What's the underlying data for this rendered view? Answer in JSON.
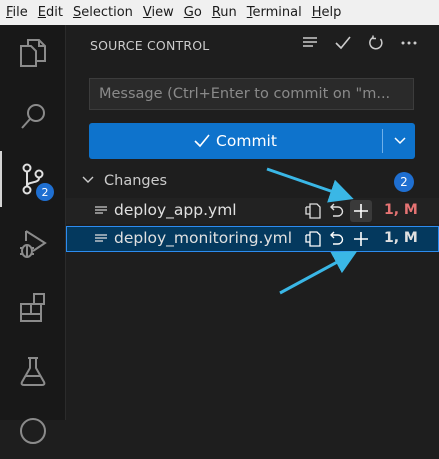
{
  "menubar": {
    "items": [
      {
        "first": "F",
        "rest": "ile"
      },
      {
        "first": "E",
        "rest": "dit"
      },
      {
        "first": "S",
        "rest": "election"
      },
      {
        "first": "V",
        "rest": "iew"
      },
      {
        "first": "G",
        "rest": "o"
      },
      {
        "first": "R",
        "rest": "un"
      },
      {
        "first": "T",
        "rest": "erminal"
      },
      {
        "first": "H",
        "rest": "elp"
      }
    ]
  },
  "activity": {
    "scm_badge": "2",
    "icons": [
      "explorer-icon",
      "search-icon",
      "source-control-icon",
      "run-debug-icon",
      "extensions-icon",
      "testing-icon",
      "accounts-icon"
    ]
  },
  "sidebar": {
    "title": "SOURCE CONTROL",
    "message_placeholder": "Message (Ctrl+Enter to commit on \"m...",
    "commit_label": "Commit",
    "changes_label": "Changes",
    "changes_count": "2",
    "files": [
      {
        "name": "deploy_app.yml",
        "status": "1, M",
        "status_color": "#e57373"
      },
      {
        "name": "deploy_monitoring.yml",
        "status": "1, M",
        "status_color": "#e0e0e0"
      }
    ]
  },
  "colors": {
    "accent": "#0e73cc",
    "badge": "#1f6fd1",
    "annotation_arrow": "#3ab7e6"
  }
}
